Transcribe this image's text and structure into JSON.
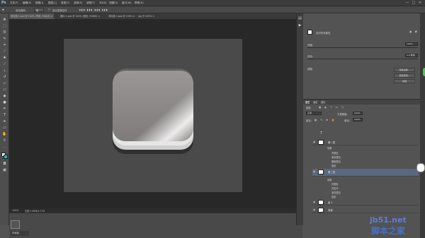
{
  "app": {
    "logo": "Ps"
  },
  "menu": {
    "items": [
      "文件(F)",
      "编辑(E)",
      "图像(I)",
      "图层(L)",
      "类型(Y)",
      "选择(S)",
      "滤镜(T)",
      "3D(D)",
      "视图(V)",
      "窗口(W)",
      "帮助(H)"
    ]
  },
  "window_controls": {
    "minimize": "—",
    "maximize": "□",
    "close": "✕"
  },
  "options_bar": {
    "auto_select_label": "自动选择：",
    "auto_select_value": "组",
    "show_transform": "显示变换控件"
  },
  "tabs": [
    {
      "label": "未标题-1.psd @ 100% (背景, RGB/8) ×"
    },
    {
      "label": "图标-1.psd @ 100% (投影, RGB/8) ×"
    },
    {
      "label": "未标题-3.psd @ 100% ×"
    },
    {
      "label": "jpg @ 100% ×"
    }
  ],
  "status": {
    "zoom": "100%",
    "doc": "文档:1.89M/4.77M"
  },
  "timeline": {
    "tab_label": "时间轴"
  },
  "properties": {
    "title": "实时形状属性",
    "density_label": "浓度:",
    "density_value": "100%",
    "feather_label": "羽化:",
    "feather_value": "0.0 像素",
    "refine_label": "调整:",
    "buttons": [
      "蒙版边缘...",
      "颜色范围...",
      "反相"
    ]
  },
  "layers": {
    "tabs": [
      "图层",
      "通道",
      "路径"
    ],
    "kind_label": "类型",
    "blend_mode": "正常",
    "opacity_label": "不透明度:",
    "opacity_value": "100%",
    "lock_label": "锁定:",
    "fill_label": "填充:",
    "fill_value": "100%",
    "rows": [
      {
        "name": "第一层",
        "selected": false
      },
      {
        "name": "第二层",
        "selected": true
      },
      {
        "name": "组 1",
        "selected": false
      },
      {
        "name": "背景",
        "selected": false
      }
    ],
    "effects_a": [
      "效果",
      "内阴影",
      "渐变叠加",
      "图案叠加",
      "投影"
    ],
    "effects_b": [
      "效果",
      "内阴影",
      "内发光",
      "渐变叠加",
      "投影"
    ]
  },
  "watermark": {
    "site": "jb51.net",
    "caption": "脚本之家"
  },
  "colors": {
    "icon_face": "#8f8b8a",
    "selected_layer": "#57697f",
    "watermark": "#5f7fd6"
  }
}
